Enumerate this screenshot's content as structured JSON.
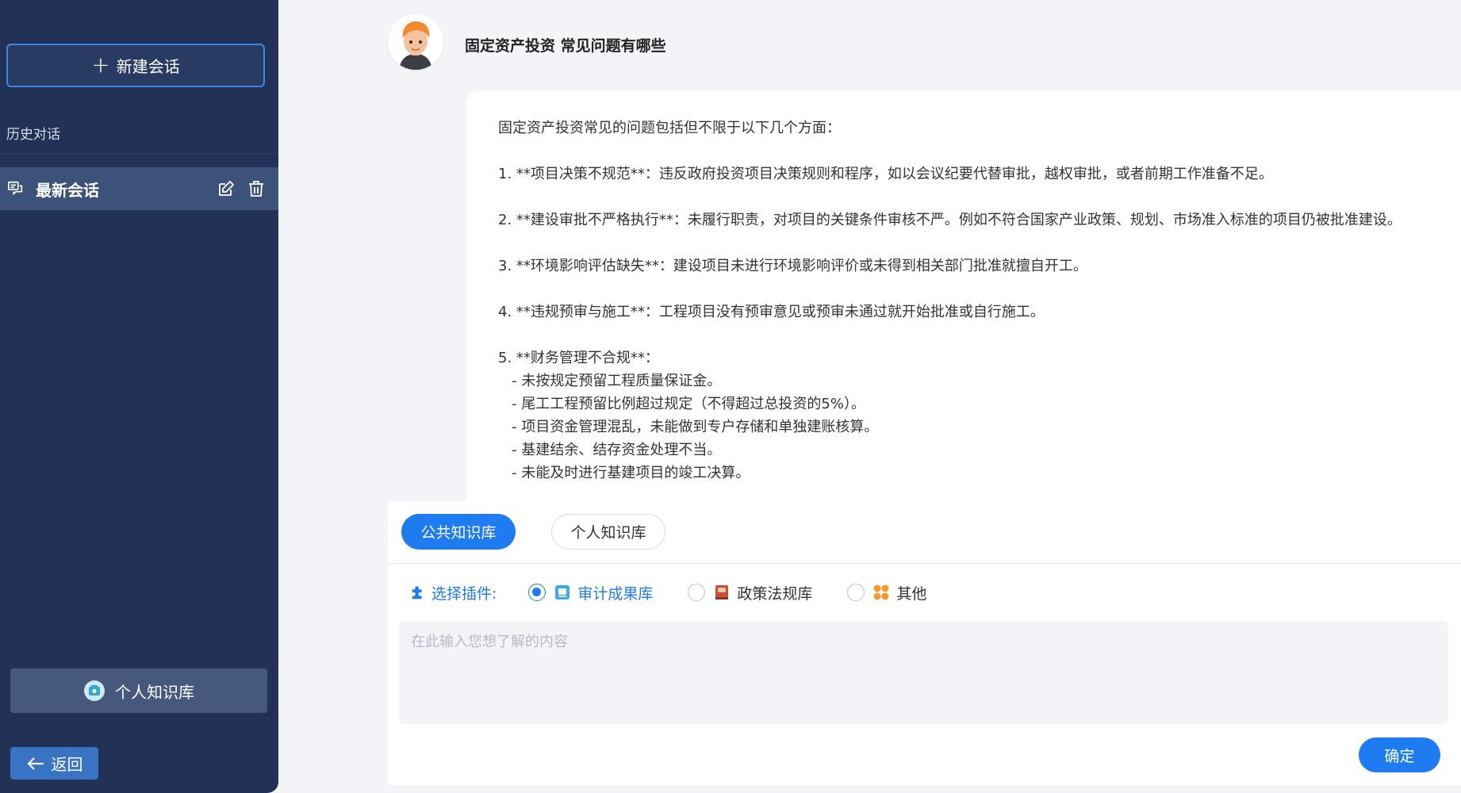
{
  "sidebar": {
    "new_chat_label": "新建会话",
    "history_title": "历史对话",
    "history_items": [
      {
        "label": "最新会话"
      }
    ],
    "knowledge_base_label": "个人知识库",
    "back_label": "返回"
  },
  "chat": {
    "question": "固定资产投资 常见问题有哪些",
    "answer": "固定资产投资常见的问题包括但不限于以下几个方面：\n\n1. **项目决策不规范**：违反政府投资项目决策规则和程序，如以会议纪要代替审批，越权审批，或者前期工作准备不足。\n\n2. **建设审批不严格执行**：未履行职责，对项目的关键条件审核不严。例如不符合国家产业政策、规划、市场准入标准的项目仍被批准建设。\n\n3. **环境影响评估缺失**：建设项目未进行环境影响评价或未得到相关部门批准就擅自开工。\n\n4. **违规预审与施工**：工程项目没有预审意见或预审未通过就开始批准或自行施工。\n\n5. **财务管理不合规**：\n   - 未按规定预留工程质量保证金。\n   - 尾工工程预留比例超过规定（不得超过总投资的5%）。\n   - 项目资金管理混乱，未能做到专户存储和单独建账核算。\n   - 基建结余、结存资金处理不当。\n   - 未能及时进行基建项目的竣工决算。"
  },
  "composer": {
    "tabs": [
      {
        "label": "公共知识库",
        "active": true
      },
      {
        "label": "个人知识库",
        "active": false
      }
    ],
    "plugin_label": "选择插件:",
    "plugins": [
      {
        "label": "审计成果库",
        "selected": true,
        "icon": "audit-results-icon"
      },
      {
        "label": "政策法规库",
        "selected": false,
        "icon": "policy-book-icon"
      },
      {
        "label": "其他",
        "selected": false,
        "icon": "other-grid-icon"
      }
    ],
    "input_placeholder": "在此输入您想了解的内容",
    "input_value": "",
    "confirm_label": "确定"
  },
  "colors": {
    "sidebar_bg": "#223156",
    "accent": "#1e7cf0",
    "page_bg": "#f2f4f8"
  }
}
